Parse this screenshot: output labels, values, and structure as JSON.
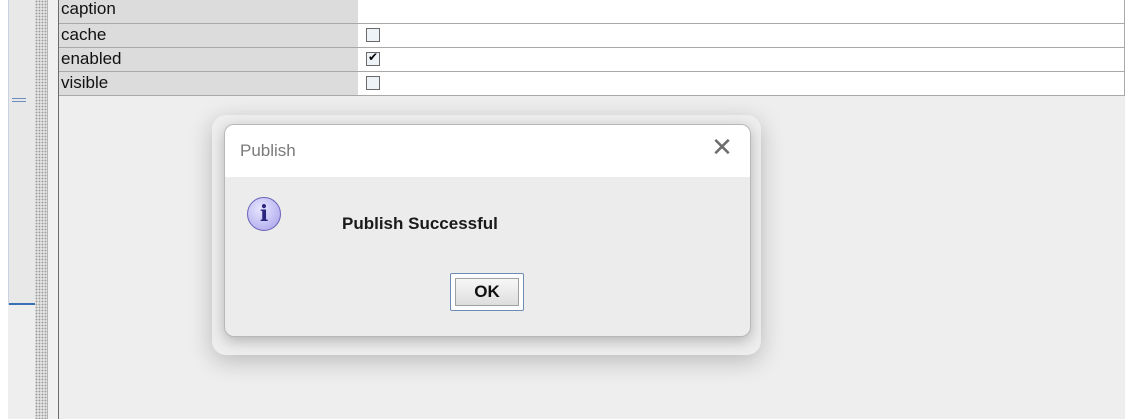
{
  "properties": [
    {
      "name": "caption",
      "type": "text",
      "value": ""
    },
    {
      "name": "cache",
      "type": "checkbox",
      "checked": false
    },
    {
      "name": "enabled",
      "type": "checkbox",
      "checked": true
    },
    {
      "name": "visible",
      "type": "checkbox",
      "checked": false
    }
  ],
  "dialog": {
    "title": "Publish",
    "close_icon": "close-icon",
    "icon": "info-icon",
    "message": "Publish Successful",
    "ok_label": "OK"
  },
  "colors": {
    "name_cell_bg": "#dcdcdc",
    "value_cell_bg": "#ffffff",
    "dialog_bg": "#ececec",
    "info_icon": "#b9b4f0",
    "accent_border": "#6e8bb5"
  }
}
